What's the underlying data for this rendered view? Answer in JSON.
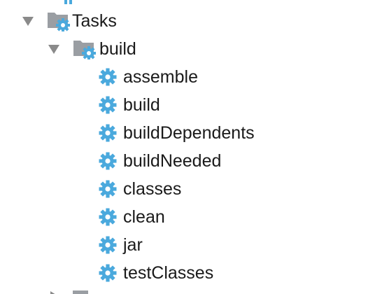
{
  "tree": {
    "tasks": {
      "label": "Tasks",
      "expanded": true,
      "icon": "folder-gear-icon",
      "children": [
        {
          "label": "build",
          "expanded": true,
          "icon": "folder-gear-icon",
          "tasks": [
            {
              "label": "assemble",
              "icon": "gear-icon"
            },
            {
              "label": "build",
              "icon": "gear-icon"
            },
            {
              "label": "buildDependents",
              "icon": "gear-icon"
            },
            {
              "label": "buildNeeded",
              "icon": "gear-icon"
            },
            {
              "label": "classes",
              "icon": "gear-icon"
            },
            {
              "label": "clean",
              "icon": "gear-icon"
            },
            {
              "label": "jar",
              "icon": "gear-icon"
            },
            {
              "label": "testClasses",
              "icon": "gear-icon"
            }
          ]
        }
      ]
    }
  },
  "colors": {
    "gear_blue": "#4aa9dd",
    "folder_gray": "#9a9ea3",
    "arrow_gray": "#8a8a8a",
    "text": "#1a1a1a"
  }
}
